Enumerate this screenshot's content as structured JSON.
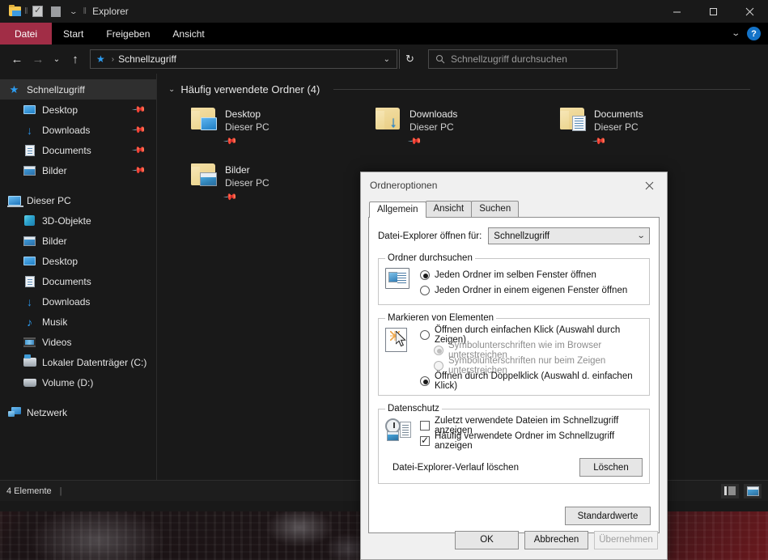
{
  "window": {
    "title": "Explorer",
    "quick_access_icons": [
      "folder-icon",
      "properties-icon",
      "new-folder-icon",
      "chevron-down-icon"
    ],
    "controls": {
      "minimize": "minimize-icon",
      "maximize": "maximize-icon",
      "close": "close-icon"
    }
  },
  "ribbon": {
    "tabs": [
      {
        "label": "Datei",
        "active": true,
        "accent": "#a12d46"
      },
      {
        "label": "Start",
        "active": false
      },
      {
        "label": "Freigeben",
        "active": false
      },
      {
        "label": "Ansicht",
        "active": false
      }
    ],
    "collapse_icon": "chevron-down-icon",
    "help_label": "?"
  },
  "nav": {
    "back": "back-arrow-icon",
    "forward": "forward-arrow-icon",
    "recent": "chevron-down-icon",
    "up": "up-arrow-icon",
    "breadcrumb_icon": "quick-access-star-icon",
    "breadcrumb": "Schnellzugriff",
    "address_chevron": "chevron-down-icon",
    "refresh": "refresh-icon",
    "search_placeholder": "Schnellzugriff durchsuchen",
    "search_value": "",
    "search_icon": "search-icon"
  },
  "sidebar": {
    "groups": [
      {
        "root": {
          "label": "Schnellzugriff",
          "icon": "star-icon",
          "selected": true
        },
        "items": [
          {
            "label": "Desktop",
            "icon": "monitor-icon",
            "pinned": true
          },
          {
            "label": "Downloads",
            "icon": "download-arrow-icon",
            "pinned": true
          },
          {
            "label": "Documents",
            "icon": "document-icon",
            "pinned": true
          },
          {
            "label": "Bilder",
            "icon": "picture-icon",
            "pinned": true
          }
        ]
      },
      {
        "root": {
          "label": "Dieser PC",
          "icon": "this-pc-icon",
          "selected": false
        },
        "items": [
          {
            "label": "3D-Objekte",
            "icon": "cube-icon",
            "pinned": false
          },
          {
            "label": "Bilder",
            "icon": "picture-icon",
            "pinned": false
          },
          {
            "label": "Desktop",
            "icon": "monitor-icon",
            "pinned": false
          },
          {
            "label": "Documents",
            "icon": "document-icon",
            "pinned": false
          },
          {
            "label": "Downloads",
            "icon": "download-arrow-icon",
            "pinned": false
          },
          {
            "label": "Musik",
            "icon": "music-note-icon",
            "pinned": false
          },
          {
            "label": "Videos",
            "icon": "video-icon",
            "pinned": false
          },
          {
            "label": "Lokaler Datenträger (C:)",
            "icon": "hard-drive-icon",
            "pinned": false
          },
          {
            "label": "Volume (D:)",
            "icon": "drive-icon",
            "pinned": false
          }
        ]
      },
      {
        "root": {
          "label": "Netzwerk",
          "icon": "network-icon",
          "selected": false
        },
        "items": []
      }
    ]
  },
  "content": {
    "group_header": "Häufig verwendete Ordner (4)",
    "group_chevron": "chevron-down-icon",
    "tiles": [
      {
        "name": "Desktop",
        "sub": "Dieser PC",
        "badge": "desktop",
        "pinned": true
      },
      {
        "name": "Downloads",
        "sub": "Dieser PC",
        "badge": "downloads",
        "pinned": true
      },
      {
        "name": "Documents",
        "sub": "Dieser PC",
        "badge": "documents",
        "pinned": true
      },
      {
        "name": "Bilder",
        "sub": "Dieser PC",
        "badge": "bilder",
        "pinned": true
      }
    ]
  },
  "statusbar": {
    "item_count": "4 Elemente",
    "separator": "|",
    "view_details_icon": "details-view-icon",
    "view_icons_icon": "large-icons-view-icon"
  },
  "dialog": {
    "title": "Ordneroptionen",
    "close_icon": "close-icon",
    "tabs": [
      {
        "label": "Allgemein",
        "active": true
      },
      {
        "label": "Ansicht",
        "active": false
      },
      {
        "label": "Suchen",
        "active": false
      }
    ],
    "open_for": {
      "label": "Datei-Explorer öffnen für:",
      "value": "Schnellzugriff",
      "chevron": "chevron-down-icon"
    },
    "browse_group": {
      "legend": "Ordner durchsuchen",
      "icon": "browse-folder-icon",
      "options": [
        {
          "label": "Jeden Ordner im selben Fenster öffnen",
          "checked": true,
          "disabled": false
        },
        {
          "label": "Jeden Ordner in einem eigenen Fenster öffnen",
          "checked": false,
          "disabled": false
        }
      ]
    },
    "click_group": {
      "legend": "Markieren von Elementen",
      "icon": "click-pointer-icon",
      "options": [
        {
          "label": "Öffnen durch einfachen Klick (Auswahl durch Zeigen)",
          "checked": false,
          "disabled": false,
          "indent": false
        },
        {
          "label": "Symbolunterschriften wie im Browser unterstreichen",
          "checked": true,
          "disabled": true,
          "indent": true
        },
        {
          "label": "Symbolunterschriften nur beim Zeigen unterstreichen",
          "checked": false,
          "disabled": true,
          "indent": true
        },
        {
          "label": "Öffnen durch Doppelklick (Auswahl d. einfachen Klick)",
          "checked": true,
          "disabled": false,
          "indent": false
        }
      ]
    },
    "privacy_group": {
      "legend": "Datenschutz",
      "icon": "privacy-history-icon",
      "checkboxes": [
        {
          "label": "Zuletzt verwendete Dateien im Schnellzugriff anzeigen",
          "checked": false
        },
        {
          "label": "Häufig verwendete Ordner im Schnellzugriff anzeigen",
          "checked": true
        }
      ],
      "clear_label": "Datei-Explorer-Verlauf löschen",
      "clear_button": "Löschen"
    },
    "defaults_button": "Standardwerte",
    "footer_buttons": [
      {
        "label": "OK",
        "disabled": false
      },
      {
        "label": "Abbrechen",
        "disabled": false
      },
      {
        "label": "Übernehmen",
        "disabled": true
      }
    ]
  }
}
